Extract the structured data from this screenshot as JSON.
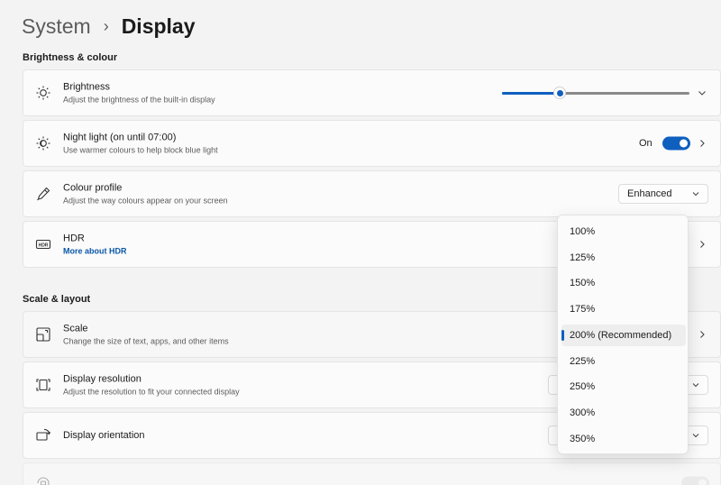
{
  "breadcrumb": {
    "parent": "System",
    "separator": "›",
    "current": "Display"
  },
  "sections": {
    "brightness": "Brightness & colour",
    "scale": "Scale & layout"
  },
  "brightness": {
    "title": "Brightness",
    "subtitle": "Adjust the brightness of the built-in display",
    "level": 0.31
  },
  "night_light": {
    "title": "Night light (on until 07:00)",
    "subtitle": "Use warmer colours to help block blue light",
    "state_label": "On"
  },
  "colour_profile": {
    "title": "Colour profile",
    "subtitle": "Adjust the way colours appear on your screen",
    "value": "Enhanced"
  },
  "hdr": {
    "title": "HDR",
    "link": "More about HDR"
  },
  "scale": {
    "title": "Scale",
    "subtitle": "Change the size of text, apps, and other items"
  },
  "resolution": {
    "title": "Display resolution",
    "subtitle": "Adjust the resolution to fit your connected display"
  },
  "orientation": {
    "title": "Display orientation"
  },
  "scale_dropdown": {
    "options": [
      "100%",
      "125%",
      "150%",
      "175%",
      "200% (Recommended)",
      "225%",
      "250%",
      "300%",
      "350%"
    ],
    "selected_index": 4
  },
  "colors": {
    "accent": "#0f5fbf",
    "link": "#0b57a8"
  }
}
